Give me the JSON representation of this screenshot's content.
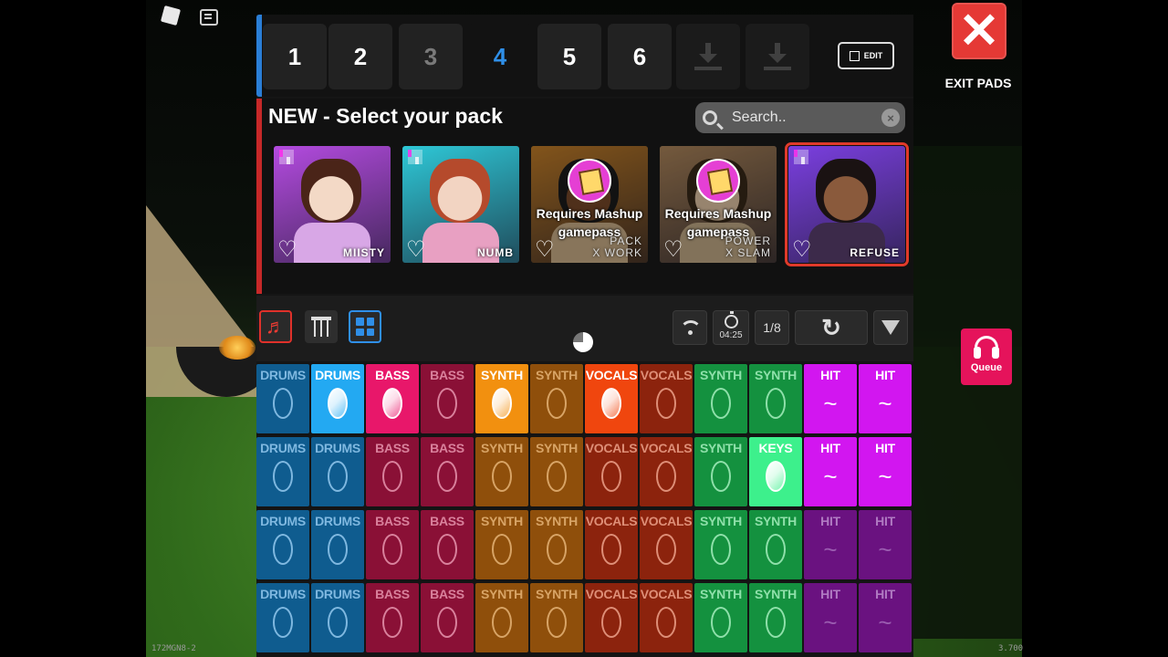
{
  "window": {
    "left_code": "172MGN8-2",
    "right_code": "3.700"
  },
  "tabs": [
    {
      "label": "1",
      "state": "normal"
    },
    {
      "label": "2",
      "state": "normal"
    },
    {
      "label": "3",
      "state": "dim"
    },
    {
      "label": "4",
      "state": "active"
    },
    {
      "label": "5",
      "state": "normal"
    },
    {
      "label": "6",
      "state": "normal"
    }
  ],
  "tab_icons": [
    "download-icon",
    "download-icon"
  ],
  "edit_label": "EDIT",
  "packs": {
    "title": "NEW - Select your pack",
    "search_placeholder": "Search..",
    "clear_glyph": "×",
    "heart_glyph": "♡",
    "cards": [
      {
        "name": "MIISTY",
        "locked": false,
        "selected": false,
        "bg": "#b44be0",
        "skin": "#f3d9c6",
        "hair": "#4a2418",
        "body": "#d8a7e6"
      },
      {
        "name": "NUMB",
        "locked": false,
        "selected": false,
        "bg": "#2ec8d7",
        "skin": "#f2d4c2",
        "hair": "#b54a2c",
        "body": "#e8a0c2"
      },
      {
        "name": "PACK X WORK",
        "name_lines": [
          "PACK",
          "X WORK"
        ],
        "locked": true,
        "lock_text": "Requires Mashup gamepass",
        "selected": false,
        "bg": "#c9822a",
        "skin": "#7a4a2a",
        "hair": "#1c1c1c",
        "body": "#d2b48c"
      },
      {
        "name": "POWER X SLAM",
        "name_lines": [
          "POWER",
          "X SLAM"
        ],
        "locked": true,
        "lock_text": "Requires Mashup gamepass",
        "selected": false,
        "bg": "#b38a5e",
        "skin": "#e9cba9",
        "hair": "#3a2a1a",
        "body": "#c8b08a"
      },
      {
        "name": "REFUSE",
        "locked": false,
        "selected": true,
        "bg": "#7b3fe0",
        "skin": "#8a5a3c",
        "hair": "#1a1212",
        "body": "#3c2a4a"
      }
    ]
  },
  "toolbar": {
    "left_icons": [
      "music-note-icon",
      "mixer-sliders-icon",
      "grid-icon"
    ],
    "note_glyph": "♬",
    "timer": "04:25",
    "quantize": "1/8",
    "refresh_glyph": "↻"
  },
  "pads": {
    "rows": [
      [
        {
          "label": "DRUMS",
          "bg": "#0f5c8f",
          "fg": "#7fb8e0",
          "state": "idle"
        },
        {
          "label": "DRUMS",
          "bg": "#23a9f2",
          "fg": "#ffffff",
          "state": "playing"
        },
        {
          "label": "BASS",
          "bg": "#e8176a",
          "fg": "#ffffff",
          "state": "playing"
        },
        {
          "label": "BASS",
          "bg": "#8a1036",
          "fg": "#d9819c",
          "state": "idle"
        },
        {
          "label": "SYNTH",
          "bg": "#f2900f",
          "fg": "#ffffff",
          "state": "playing"
        },
        {
          "label": "SYNTH",
          "bg": "#8f4f0b",
          "fg": "#d8a466",
          "state": "idle"
        },
        {
          "label": "VOCALS",
          "bg": "#f0460e",
          "fg": "#ffffff",
          "state": "playing"
        },
        {
          "label": "VOCALS",
          "bg": "#8c230d",
          "fg": "#de8e77",
          "state": "idle"
        },
        {
          "label": "SYNTH",
          "bg": "#14913f",
          "fg": "#8fe0aa",
          "state": "idle"
        },
        {
          "label": "SYNTH",
          "bg": "#14913f",
          "fg": "#8fe0aa",
          "state": "idle"
        },
        {
          "label": "HIT",
          "bg": "#d216f0",
          "fg": "#ffffff",
          "state": "hit-active"
        },
        {
          "label": "HIT",
          "bg": "#d216f0",
          "fg": "#ffffff",
          "state": "hit-active"
        }
      ],
      [
        {
          "label": "DRUMS",
          "bg": "#0f5c8f",
          "fg": "#7fb8e0",
          "state": "idle"
        },
        {
          "label": "DRUMS",
          "bg": "#0f5c8f",
          "fg": "#7fb8e0",
          "state": "idle"
        },
        {
          "label": "BASS",
          "bg": "#8a1036",
          "fg": "#d9819c",
          "state": "idle"
        },
        {
          "label": "BASS",
          "bg": "#8a1036",
          "fg": "#d9819c",
          "state": "idle"
        },
        {
          "label": "SYNTH",
          "bg": "#8f4f0b",
          "fg": "#d8a466",
          "state": "idle"
        },
        {
          "label": "SYNTH",
          "bg": "#8f4f0b",
          "fg": "#d8a466",
          "state": "idle"
        },
        {
          "label": "VOCALS",
          "bg": "#8c230d",
          "fg": "#de8e77",
          "state": "idle"
        },
        {
          "label": "VOCALS",
          "bg": "#8c230d",
          "fg": "#de8e77",
          "state": "idle"
        },
        {
          "label": "SYNTH",
          "bg": "#14913f",
          "fg": "#8fe0aa",
          "state": "idle"
        },
        {
          "label": "KEYS",
          "bg": "#3df08c",
          "fg": "#ffffff",
          "state": "playing"
        },
        {
          "label": "HIT",
          "bg": "#d216f0",
          "fg": "#ffffff",
          "state": "hit-active"
        },
        {
          "label": "HIT",
          "bg": "#d216f0",
          "fg": "#ffffff",
          "state": "hit-active"
        }
      ],
      [
        {
          "label": "DRUMS",
          "bg": "#0f5c8f",
          "fg": "#7fb8e0",
          "state": "idle"
        },
        {
          "label": "DRUMS",
          "bg": "#0f5c8f",
          "fg": "#7fb8e0",
          "state": "idle"
        },
        {
          "label": "BASS",
          "bg": "#8a1036",
          "fg": "#d9819c",
          "state": "idle"
        },
        {
          "label": "BASS",
          "bg": "#8a1036",
          "fg": "#d9819c",
          "state": "idle"
        },
        {
          "label": "SYNTH",
          "bg": "#8f4f0b",
          "fg": "#d8a466",
          "state": "idle"
        },
        {
          "label": "SYNTH",
          "bg": "#8f4f0b",
          "fg": "#d8a466",
          "state": "idle"
        },
        {
          "label": "VOCALS",
          "bg": "#8c230d",
          "fg": "#de8e77",
          "state": "idle"
        },
        {
          "label": "VOCALS",
          "bg": "#8c230d",
          "fg": "#de8e77",
          "state": "idle"
        },
        {
          "label": "SYNTH",
          "bg": "#14913f",
          "fg": "#8fe0aa",
          "state": "idle"
        },
        {
          "label": "SYNTH",
          "bg": "#14913f",
          "fg": "#8fe0aa",
          "state": "idle"
        },
        {
          "label": "HIT",
          "bg": "#6a1280",
          "fg": "#b07ac2",
          "state": "hit-idle"
        },
        {
          "label": "HIT",
          "bg": "#6a1280",
          "fg": "#b07ac2",
          "state": "hit-idle"
        }
      ],
      [
        {
          "label": "DRUMS",
          "bg": "#0f5c8f",
          "fg": "#7fb8e0",
          "state": "idle"
        },
        {
          "label": "DRUMS",
          "bg": "#0f5c8f",
          "fg": "#7fb8e0",
          "state": "idle"
        },
        {
          "label": "BASS",
          "bg": "#8a1036",
          "fg": "#d9819c",
          "state": "idle"
        },
        {
          "label": "BASS",
          "bg": "#8a1036",
          "fg": "#d9819c",
          "state": "idle"
        },
        {
          "label": "SYNTH",
          "bg": "#8f4f0b",
          "fg": "#d8a466",
          "state": "idle"
        },
        {
          "label": "SYNTH",
          "bg": "#8f4f0b",
          "fg": "#d8a466",
          "state": "idle"
        },
        {
          "label": "VOCALS",
          "bg": "#8c230d",
          "fg": "#de8e77",
          "state": "idle"
        },
        {
          "label": "VOCALS",
          "bg": "#8c230d",
          "fg": "#de8e77",
          "state": "idle"
        },
        {
          "label": "SYNTH",
          "bg": "#14913f",
          "fg": "#8fe0aa",
          "state": "idle"
        },
        {
          "label": "SYNTH",
          "bg": "#14913f",
          "fg": "#8fe0aa",
          "state": "idle"
        },
        {
          "label": "HIT",
          "bg": "#6a1280",
          "fg": "#b07ac2",
          "state": "hit-idle"
        },
        {
          "label": "HIT",
          "bg": "#6a1280",
          "fg": "#b07ac2",
          "state": "hit-idle"
        }
      ]
    ]
  },
  "exit": {
    "glyph": "✕",
    "label": "EXIT PADS"
  },
  "queue": {
    "label": "Queue"
  }
}
